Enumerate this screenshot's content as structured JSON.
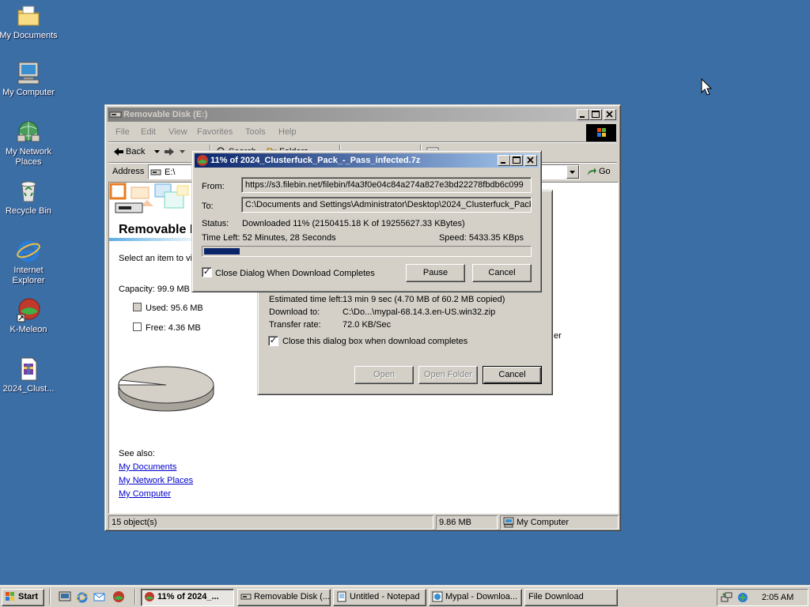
{
  "desktop": {
    "icons": [
      {
        "label": "My Documents",
        "icon": "folder-documents-icon"
      },
      {
        "label": "My Computer",
        "icon": "computer-icon"
      },
      {
        "label": "My Network Places",
        "icon": "network-places-icon"
      },
      {
        "label": "Recycle Bin",
        "icon": "recycle-bin-icon"
      },
      {
        "label": "Internet Explorer",
        "icon": "internet-explorer-icon"
      },
      {
        "label": "K-Meleon",
        "icon": "k-meleon-icon"
      },
      {
        "label": "2024_Clust...",
        "icon": "archive-file-icon"
      }
    ]
  },
  "explorer": {
    "title": "Removable Disk (E:)",
    "menu": [
      "File",
      "Edit",
      "View",
      "Favorites",
      "Tools",
      "Help"
    ],
    "toolbar": {
      "back": "Back",
      "search": "Search",
      "folders": "Folders"
    },
    "address_label": "Address",
    "address_value": "E:\\",
    "go": "Go",
    "heading": "Removable Disk (E:)",
    "select_text": "Select an item to view its description.",
    "capacity": "Capacity: 99.9 MB",
    "used": "Used: 95.6 MB",
    "free": "Free: 4.36 MB",
    "used_fraction": 0.957,
    "see_also": "See also:",
    "links": [
      "My Documents",
      "My Network Places",
      "My Computer"
    ],
    "status_objects": "15 object(s)",
    "status_size": "9.86 MB",
    "status_zone": "My Computer",
    "behind_fragment": "er"
  },
  "file_download": {
    "estimated_label": "Estimated time left:",
    "estimated_value": "13 min 9 sec (4.70 MB of 60.2 MB copied)",
    "download_to_label": "Download to:",
    "download_to_value": "C:\\Do...\\mypal-68.14.3.en-US.win32.zip",
    "rate_label": "Transfer rate:",
    "rate_value": "72.0 KB/Sec",
    "close_checkbox": "Close this dialog box when download completes",
    "open": "Open",
    "open_folder": "Open Folder",
    "cancel": "Cancel"
  },
  "download": {
    "title": "11% of 2024_Clusterfuck_Pack_-_Pass_infected.7z",
    "from_label": "From:",
    "from_value": "https://s3.filebin.net/filebin/f4a3f0e04c84a274a827e3bd22278fbdb6c099",
    "to_label": "To:",
    "to_value": "C:\\Documents and Settings\\Administrator\\Desktop\\2024_Clusterfuck_Pack",
    "status_label": "Status:",
    "status_value": "Downloaded 11% (2150415.18 K of 19255627.33 KBytes)",
    "time_left": "Time Left: 52 Minutes, 28 Seconds",
    "speed": "Speed: 5433.35 KBps",
    "progress": 0.11,
    "close_checkbox": "Close Dialog When Download Completes",
    "pause": "Pause",
    "cancel": "Cancel"
  },
  "taskbar": {
    "start": "Start",
    "tasks": [
      {
        "label": "11% of 2024_...",
        "icon": "k-meleon-icon"
      },
      {
        "label": "Removable Disk (...",
        "icon": "drive-icon"
      },
      {
        "label": "Untitled - Notepad",
        "icon": "notepad-icon"
      },
      {
        "label": "Mypal - Downloa...",
        "icon": "mypal-icon"
      },
      {
        "label": "File Download",
        "icon": ""
      }
    ],
    "clock": "2:05 AM"
  }
}
